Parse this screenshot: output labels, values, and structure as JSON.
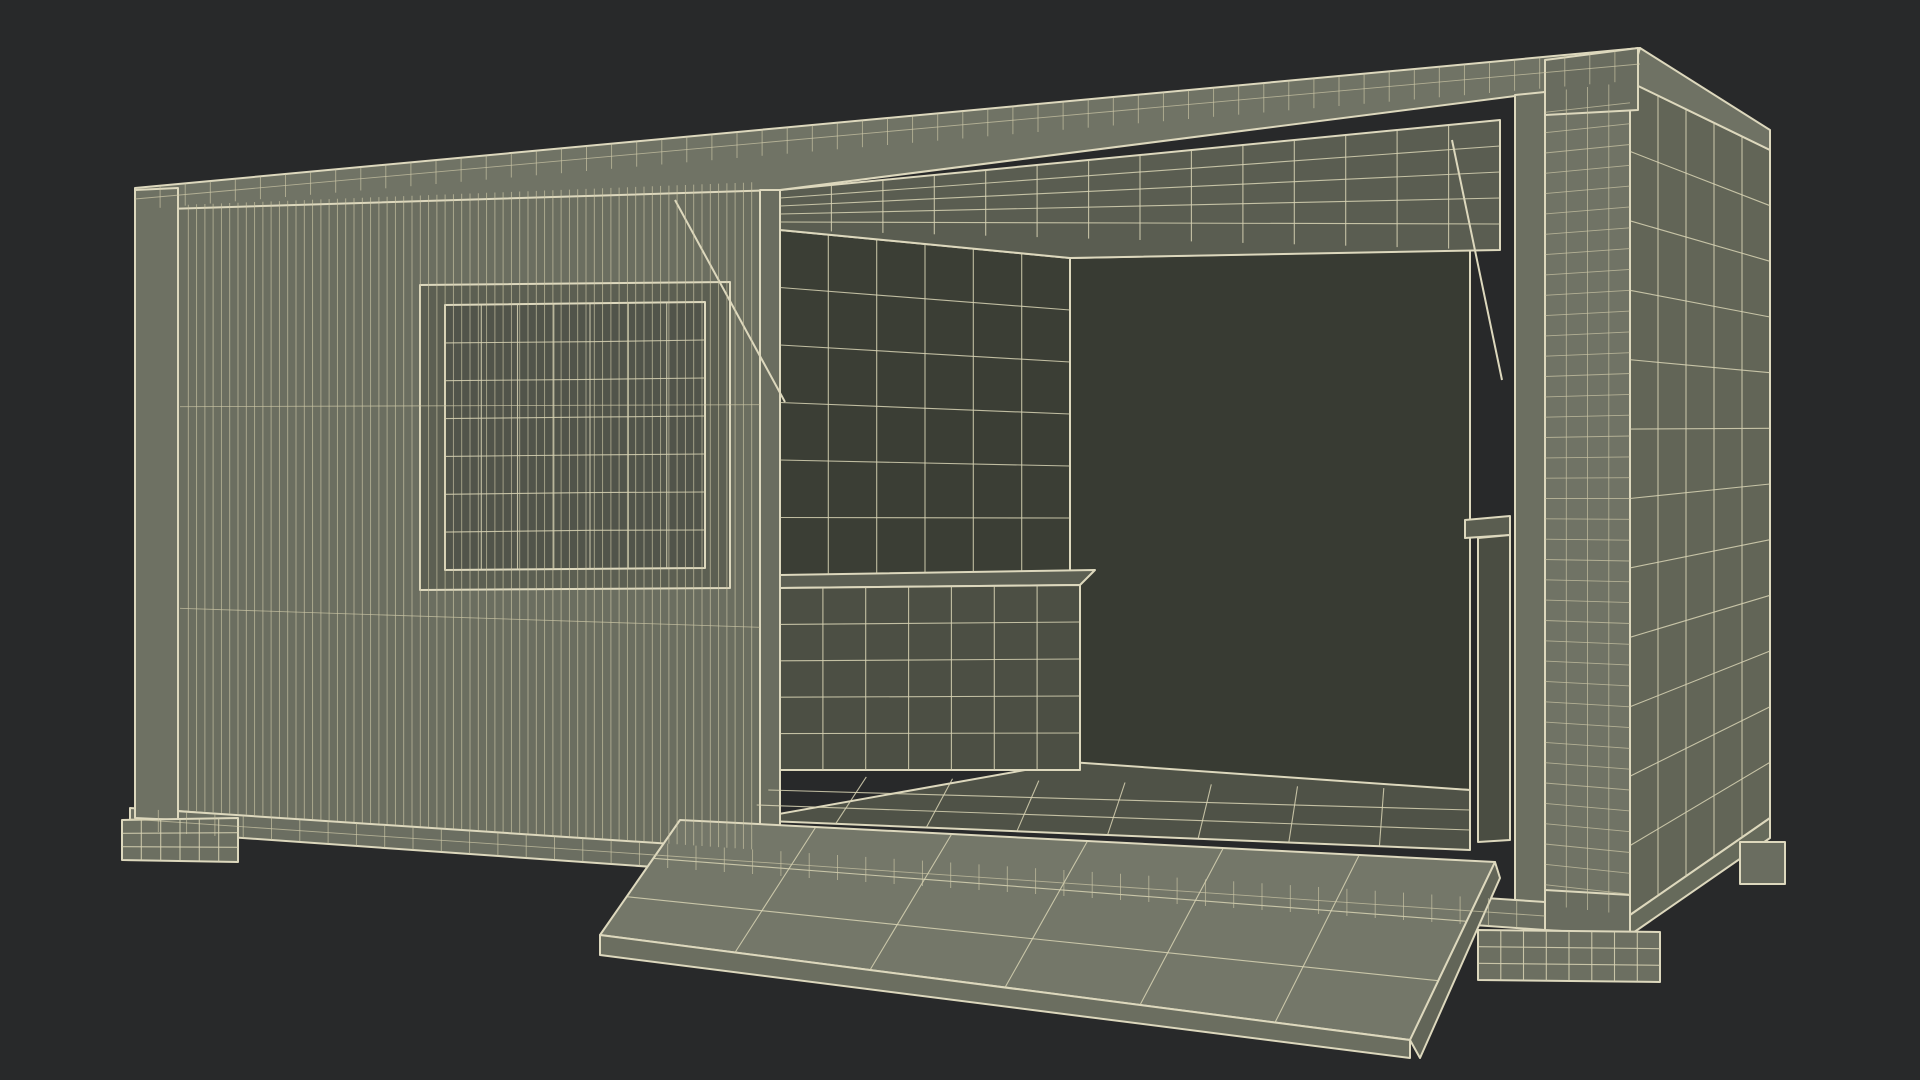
{
  "scene": {
    "subject": "wireframe-container-kiosk",
    "colors": {
      "background": "#28292a",
      "wire": "#ddd8bd",
      "surface_light": "#6e7163",
      "surface_mid": "#5f6255",
      "surface_dark": "#3c3f35",
      "surface_shadow": "#2f322b"
    }
  }
}
